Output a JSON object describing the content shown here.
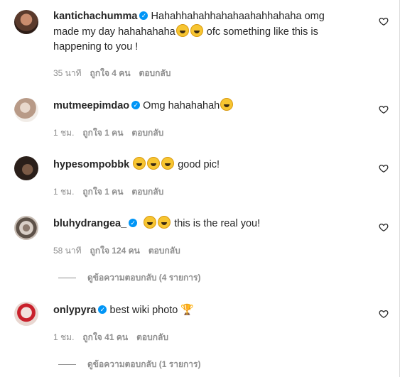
{
  "comments": [
    {
      "username": "kanticha­chumma",
      "text_line1": "Hahahhahahhahahaahahhahaha omg",
      "text_line2a": "made my day hahahahaha",
      "text_line2b": "ofc something like this is",
      "text_line3": "happening to you !",
      "time": "35 นาที",
      "likes": "ถูกใจ 4 คน",
      "reply": "ตอบกลับ"
    },
    {
      "username": "mutmeepimdao",
      "text": "Omg hahahahah",
      "time": "1 ชม.",
      "likes": "ถูกใจ 1 คน",
      "reply": "ตอบกลับ"
    },
    {
      "username": "hypesompobbk",
      "text": "good pic!",
      "time": "1 ชม.",
      "likes": "ถูกใจ 1 คน",
      "reply": "ตอบกลับ"
    },
    {
      "username": "bluhydrangea_",
      "text": "this is the real you!",
      "time": "58 นาที",
      "likes": "ถูกใจ 124 คน",
      "reply": "ตอบกลับ",
      "view_replies": "ดูข้อความตอบกลับ (4 รายการ)"
    },
    {
      "username": "onlypyra",
      "text": "best wiki photo",
      "time": "1 ชม.",
      "likes": "ถูกใจ 41 คน",
      "reply": "ตอบกลับ",
      "view_replies": "ดูข้อความตอบกลับ (1 รายการ)"
    }
  ],
  "icons": {
    "heart": "heart-outline-icon",
    "verified": "verified-badge-icon",
    "emoji_grin": "grinning-squinting-emoji",
    "emoji_rofl": "rolling-on-floor-laughing-emoji",
    "emoji_trophy": "trophy-emoji"
  },
  "colors": {
    "verified": "#0095f6",
    "meta_text": "#8e8e8e",
    "text": "#262626"
  }
}
